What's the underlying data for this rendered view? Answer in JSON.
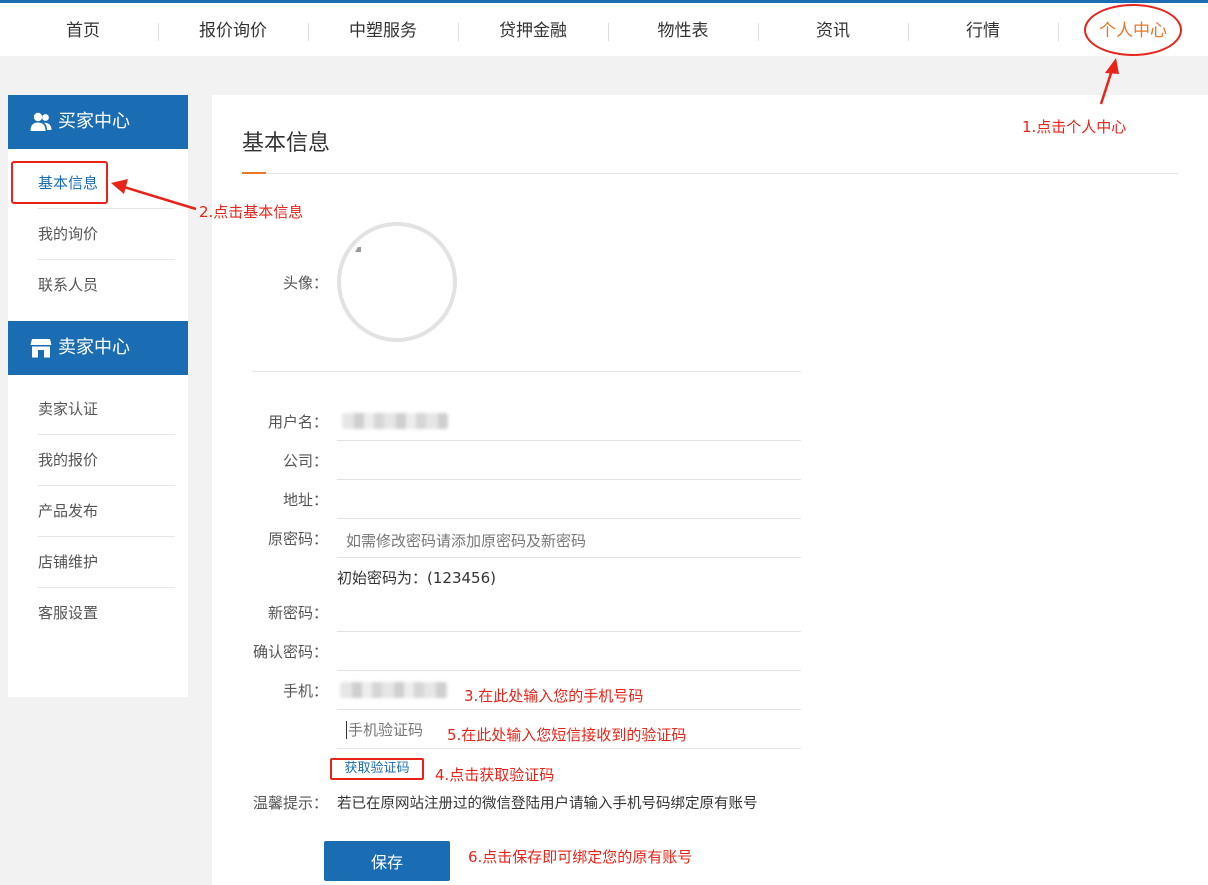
{
  "nav": {
    "items": [
      "首页",
      "报价询价",
      "中塑服务",
      "贷押金融",
      "物性表",
      "资讯",
      "行情",
      "个人中心"
    ],
    "active_index": 7
  },
  "sidebar": {
    "buyer_title": "买家中心",
    "buyer_icon": "users-icon",
    "buyer_items": [
      "基本信息",
      "我的询价",
      "联系人员"
    ],
    "seller_title": "卖家中心",
    "seller_icon": "store-icon",
    "seller_items": [
      "卖家认证",
      "我的报价",
      "产品发布",
      "店铺维护",
      "客服设置"
    ],
    "active_item": "基本信息"
  },
  "main": {
    "title": "基本信息",
    "avatar_label": "头像：",
    "username_label": "用户名：",
    "company_label": "公司：",
    "address_label": "地址：",
    "old_password_label": "原密码：",
    "old_password_placeholder": "如需修改密码请添加原密码及新密码",
    "initial_password_note": "初始密码为：(123456)",
    "new_password_label": "新密码：",
    "confirm_password_label": "确认密码：",
    "phone_label": "手机：",
    "sms_code_placeholder": "手机验证码",
    "get_code_button": "获取验证码",
    "tip_label": "温馨提示：",
    "tip_text": "若已在原网站注册过的微信登陆用户请输入手机号码绑定原有账号",
    "save_button": "保存"
  },
  "annotations": {
    "step1": "1.点击个人中心",
    "step2": "2.点击基本信息",
    "step3": "3.在此处输入您的手机号码",
    "step4": "4.点击获取验证码",
    "step5": "5.在此处输入您短信接收到的验证码",
    "step6": "6.点击保存即可绑定您的原有账号",
    "color": "#e8241a"
  },
  "theme": {
    "primary": "#1b6db3",
    "accent": "#e8782a"
  }
}
